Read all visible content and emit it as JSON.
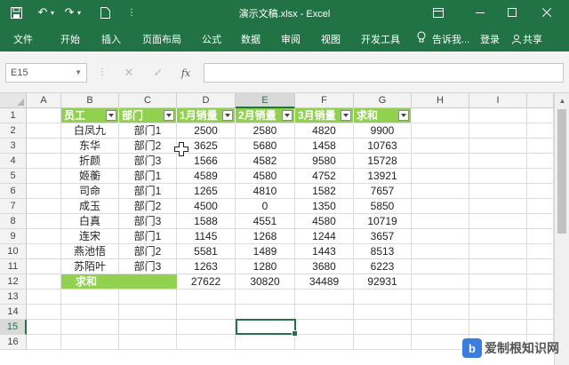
{
  "window": {
    "title": "演示文稿.xlsx - Excel",
    "icons": [
      "save-icon",
      "undo-icon",
      "redo-icon",
      "new-file-icon",
      "customize-qat-icon",
      "ribbon-display-icon",
      "minimize-icon",
      "maximize-icon",
      "close-icon"
    ]
  },
  "ribbon": {
    "tabs": [
      "文件",
      "开始",
      "插入",
      "页面布局",
      "公式",
      "数据",
      "审阅",
      "视图",
      "开发工具"
    ],
    "tell_me": "告诉我...",
    "sign_in": "登录",
    "share": "共享"
  },
  "formula_bar": {
    "name_box": "E15",
    "fx_label": "fx",
    "formula": ""
  },
  "sheet": {
    "columns": [
      "A",
      "B",
      "C",
      "D",
      "E",
      "F",
      "G",
      "H",
      "I"
    ],
    "rows": [
      "1",
      "2",
      "3",
      "4",
      "5",
      "6",
      "7",
      "8",
      "9",
      "10",
      "11",
      "12",
      "13",
      "14",
      "15",
      "16"
    ],
    "header_row": [
      "员工",
      "部门",
      "1月销量",
      "2月销量",
      "3月销量",
      "求和"
    ],
    "data": [
      [
        "白凤九",
        "部门1",
        "2500",
        "2580",
        "4820",
        "9900"
      ],
      [
        "东华",
        "部门2",
        "3625",
        "5680",
        "1458",
        "10763"
      ],
      [
        "折颜",
        "部门3",
        "1566",
        "4582",
        "9580",
        "15728"
      ],
      [
        "姬蘅",
        "部门1",
        "4589",
        "4580",
        "4752",
        "13921"
      ],
      [
        "司命",
        "部门1",
        "1265",
        "4810",
        "1582",
        "7657"
      ],
      [
        "成玉",
        "部门2",
        "4500",
        "0",
        "1350",
        "5850"
      ],
      [
        "白真",
        "部门3",
        "1588",
        "4551",
        "4580",
        "10719"
      ],
      [
        "连宋",
        "部门1",
        "1145",
        "1268",
        "1244",
        "3657"
      ],
      [
        "燕池悟",
        "部门2",
        "5581",
        "1489",
        "1443",
        "8513"
      ],
      [
        "苏陌叶",
        "部门3",
        "1263",
        "1280",
        "3680",
        "6223"
      ]
    ],
    "total_row": [
      "求和",
      "",
      "27622",
      "30820",
      "34489",
      "92931"
    ],
    "selected_cell": "E15",
    "accent": "#217346",
    "table_fill": "#92d050"
  },
  "watermark": {
    "badge": "b",
    "text": "爱制根知识网"
  }
}
